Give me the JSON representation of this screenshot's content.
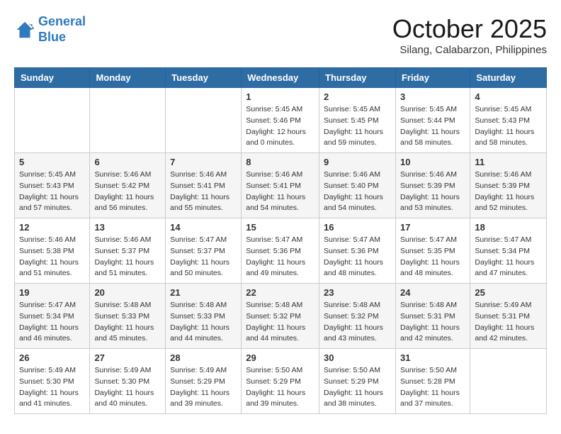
{
  "logo": {
    "line1": "General",
    "line2": "Blue"
  },
  "title": "October 2025",
  "subtitle": "Silang, Calabarzon, Philippines",
  "days_header": [
    "Sunday",
    "Monday",
    "Tuesday",
    "Wednesday",
    "Thursday",
    "Friday",
    "Saturday"
  ],
  "weeks": [
    [
      {
        "day": "",
        "info": ""
      },
      {
        "day": "",
        "info": ""
      },
      {
        "day": "",
        "info": ""
      },
      {
        "day": "1",
        "info": "Sunrise: 5:45 AM\nSunset: 5:46 PM\nDaylight: 12 hours\nand 0 minutes."
      },
      {
        "day": "2",
        "info": "Sunrise: 5:45 AM\nSunset: 5:45 PM\nDaylight: 11 hours\nand 59 minutes."
      },
      {
        "day": "3",
        "info": "Sunrise: 5:45 AM\nSunset: 5:44 PM\nDaylight: 11 hours\nand 58 minutes."
      },
      {
        "day": "4",
        "info": "Sunrise: 5:45 AM\nSunset: 5:43 PM\nDaylight: 11 hours\nand 58 minutes."
      }
    ],
    [
      {
        "day": "5",
        "info": "Sunrise: 5:45 AM\nSunset: 5:43 PM\nDaylight: 11 hours\nand 57 minutes."
      },
      {
        "day": "6",
        "info": "Sunrise: 5:46 AM\nSunset: 5:42 PM\nDaylight: 11 hours\nand 56 minutes."
      },
      {
        "day": "7",
        "info": "Sunrise: 5:46 AM\nSunset: 5:41 PM\nDaylight: 11 hours\nand 55 minutes."
      },
      {
        "day": "8",
        "info": "Sunrise: 5:46 AM\nSunset: 5:41 PM\nDaylight: 11 hours\nand 54 minutes."
      },
      {
        "day": "9",
        "info": "Sunrise: 5:46 AM\nSunset: 5:40 PM\nDaylight: 11 hours\nand 54 minutes."
      },
      {
        "day": "10",
        "info": "Sunrise: 5:46 AM\nSunset: 5:39 PM\nDaylight: 11 hours\nand 53 minutes."
      },
      {
        "day": "11",
        "info": "Sunrise: 5:46 AM\nSunset: 5:39 PM\nDaylight: 11 hours\nand 52 minutes."
      }
    ],
    [
      {
        "day": "12",
        "info": "Sunrise: 5:46 AM\nSunset: 5:38 PM\nDaylight: 11 hours\nand 51 minutes."
      },
      {
        "day": "13",
        "info": "Sunrise: 5:46 AM\nSunset: 5:37 PM\nDaylight: 11 hours\nand 51 minutes."
      },
      {
        "day": "14",
        "info": "Sunrise: 5:47 AM\nSunset: 5:37 PM\nDaylight: 11 hours\nand 50 minutes."
      },
      {
        "day": "15",
        "info": "Sunrise: 5:47 AM\nSunset: 5:36 PM\nDaylight: 11 hours\nand 49 minutes."
      },
      {
        "day": "16",
        "info": "Sunrise: 5:47 AM\nSunset: 5:36 PM\nDaylight: 11 hours\nand 48 minutes."
      },
      {
        "day": "17",
        "info": "Sunrise: 5:47 AM\nSunset: 5:35 PM\nDaylight: 11 hours\nand 48 minutes."
      },
      {
        "day": "18",
        "info": "Sunrise: 5:47 AM\nSunset: 5:34 PM\nDaylight: 11 hours\nand 47 minutes."
      }
    ],
    [
      {
        "day": "19",
        "info": "Sunrise: 5:47 AM\nSunset: 5:34 PM\nDaylight: 11 hours\nand 46 minutes."
      },
      {
        "day": "20",
        "info": "Sunrise: 5:48 AM\nSunset: 5:33 PM\nDaylight: 11 hours\nand 45 minutes."
      },
      {
        "day": "21",
        "info": "Sunrise: 5:48 AM\nSunset: 5:33 PM\nDaylight: 11 hours\nand 44 minutes."
      },
      {
        "day": "22",
        "info": "Sunrise: 5:48 AM\nSunset: 5:32 PM\nDaylight: 11 hours\nand 44 minutes."
      },
      {
        "day": "23",
        "info": "Sunrise: 5:48 AM\nSunset: 5:32 PM\nDaylight: 11 hours\nand 43 minutes."
      },
      {
        "day": "24",
        "info": "Sunrise: 5:48 AM\nSunset: 5:31 PM\nDaylight: 11 hours\nand 42 minutes."
      },
      {
        "day": "25",
        "info": "Sunrise: 5:49 AM\nSunset: 5:31 PM\nDaylight: 11 hours\nand 42 minutes."
      }
    ],
    [
      {
        "day": "26",
        "info": "Sunrise: 5:49 AM\nSunset: 5:30 PM\nDaylight: 11 hours\nand 41 minutes."
      },
      {
        "day": "27",
        "info": "Sunrise: 5:49 AM\nSunset: 5:30 PM\nDaylight: 11 hours\nand 40 minutes."
      },
      {
        "day": "28",
        "info": "Sunrise: 5:49 AM\nSunset: 5:29 PM\nDaylight: 11 hours\nand 39 minutes."
      },
      {
        "day": "29",
        "info": "Sunrise: 5:50 AM\nSunset: 5:29 PM\nDaylight: 11 hours\nand 39 minutes."
      },
      {
        "day": "30",
        "info": "Sunrise: 5:50 AM\nSunset: 5:29 PM\nDaylight: 11 hours\nand 38 minutes."
      },
      {
        "day": "31",
        "info": "Sunrise: 5:50 AM\nSunset: 5:28 PM\nDaylight: 11 hours\nand 37 minutes."
      },
      {
        "day": "",
        "info": ""
      }
    ]
  ]
}
